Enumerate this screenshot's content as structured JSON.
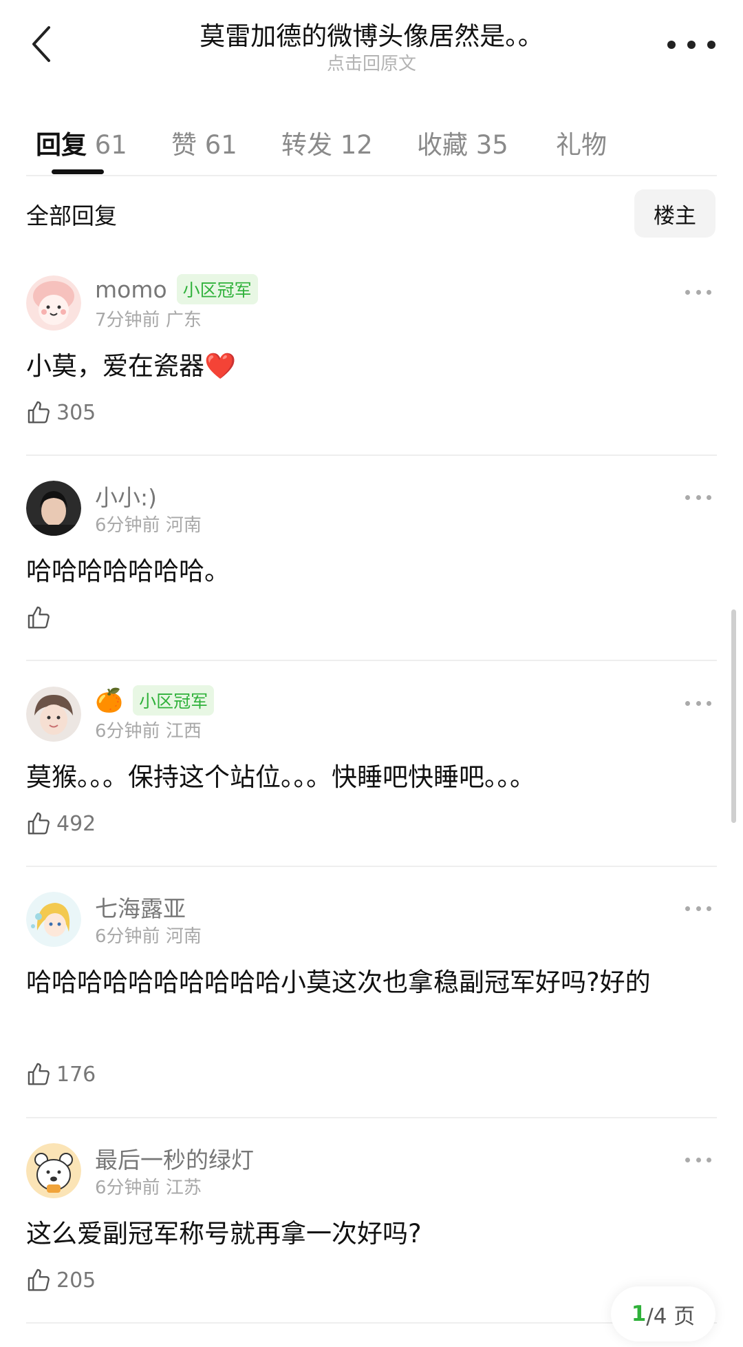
{
  "header": {
    "title": "莫雷加德的微博头像居然是。。",
    "subtitle": "点击回原文"
  },
  "tabs": [
    {
      "label": "回复",
      "count": "61",
      "active": true
    },
    {
      "label": "赞",
      "count": "61",
      "active": false
    },
    {
      "label": "转发",
      "count": "12",
      "active": false
    },
    {
      "label": "收藏",
      "count": "35",
      "active": false
    },
    {
      "label": "礼物",
      "count": "",
      "active": false
    }
  ],
  "filter": {
    "label": "全部回复",
    "owner_button": "楼主"
  },
  "comments": [
    {
      "username": "momo",
      "badge": "小区冠军",
      "time": "7分钟前",
      "location": "广东",
      "text": "小莫，爱在瓷器",
      "emoji": "❤️",
      "likes": "305"
    },
    {
      "username": "小小:)",
      "badge": "",
      "time": "6分钟前",
      "location": "河南",
      "text": "哈哈哈哈哈哈哈。",
      "likes": ""
    },
    {
      "username": "🍊",
      "badge": "小区冠军",
      "time": "6分钟前",
      "location": "江西",
      "text": "莫猴。。。保持这个站位。。。快睡吧快睡吧。。。",
      "likes": "492"
    },
    {
      "username": "七海露亚",
      "badge": "",
      "time": "6分钟前",
      "location": "河南",
      "text": "哈哈哈哈哈哈哈哈哈哈小莫这次也拿稳副冠军好吗?好的",
      "likes": "176"
    },
    {
      "username": "最后一秒的绿灯",
      "badge": "",
      "time": "6分钟前",
      "location": "江苏",
      "text": "这么爱副冠军称号就再拿一次好吗?",
      "likes": "205"
    }
  ],
  "pagination": {
    "current": "1",
    "total_text": "/4 页"
  },
  "colors": {
    "accent_green": "#2fb13a",
    "badge_bg": "#e8f7e4",
    "meta_gray": "#a8a8a8"
  }
}
